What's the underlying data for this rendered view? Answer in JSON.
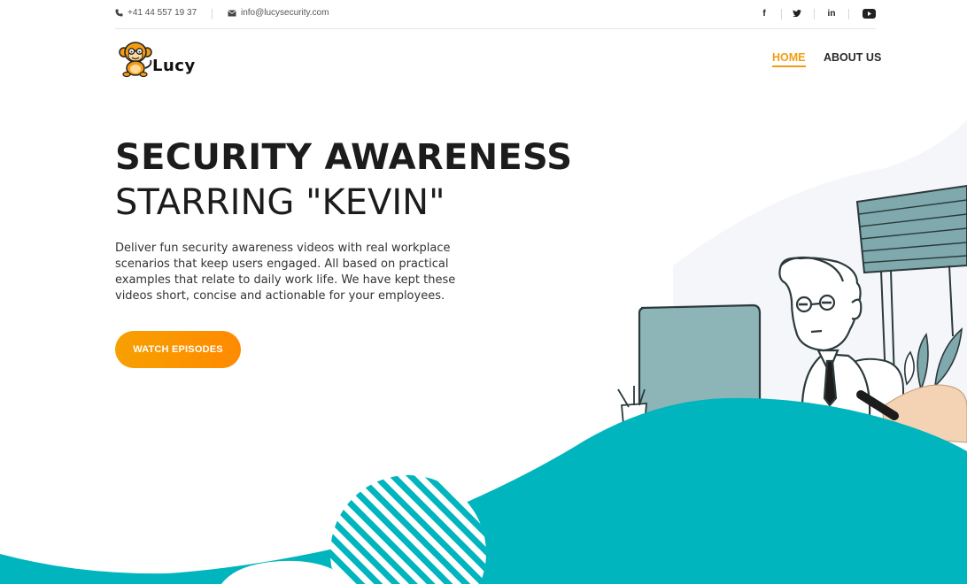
{
  "topbar": {
    "phone": "+41 44 557 19 37",
    "email": "info@lucysecurity.com",
    "social": [
      {
        "icon": "facebook-icon",
        "glyph": "f"
      },
      {
        "icon": "twitter-icon",
        "glyph": ""
      },
      {
        "icon": "linkedin-icon",
        "glyph": "in"
      },
      {
        "icon": "youtube-icon",
        "glyph": ""
      }
    ]
  },
  "brand": {
    "logo_text": "Lucy",
    "logo_icon": "monkey-mascot"
  },
  "nav": {
    "items": [
      {
        "label": "HOME",
        "active": true
      },
      {
        "label": "ABOUT US",
        "active": false
      }
    ]
  },
  "hero": {
    "title_line1": "SECURITY AWARENESS",
    "title_line2": "STARRING \"KEVIN\"",
    "description": "Deliver fun security awareness videos with real workplace scenarios that keep users engaged. All based on practical examples that relate to daily work life. We have kept these videos short, concise and actionable for your employees.",
    "cta_label": "WATCH EPISODES"
  },
  "colors": {
    "accent": "#f39c12",
    "cta_start": "#f7a000",
    "cta_end": "#ff8a00",
    "wave": "#00b5bd",
    "illustration_teal": "#7fa9ad"
  }
}
